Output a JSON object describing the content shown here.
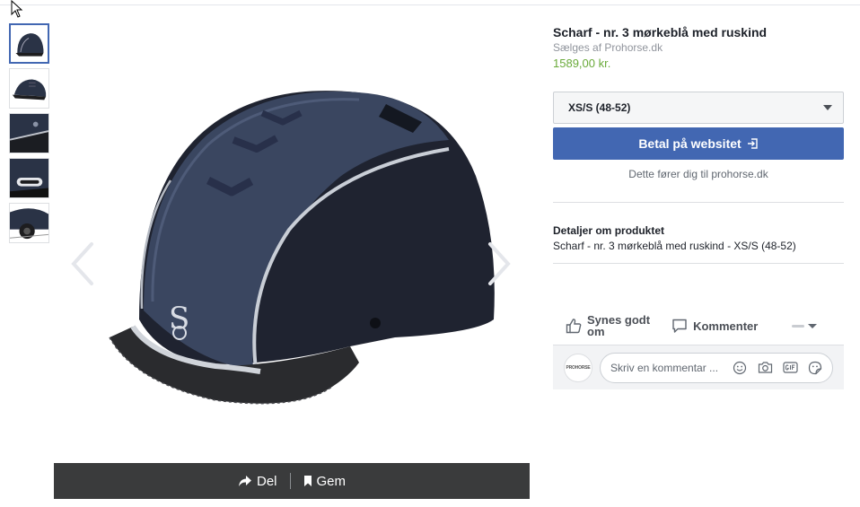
{
  "product": {
    "title": "Scharf - nr. 3 mørkeblå med ruskind",
    "seller": "Sælges af Prohorse.dk",
    "price": "1589,00 kr."
  },
  "size_select": {
    "selected": "XS/S (48-52)"
  },
  "pay_button": {
    "label": "Betal på websitet"
  },
  "redirect_note": "Dette fører dig til prohorse.dk",
  "details": {
    "heading": "Detaljer om produktet",
    "text": "Scharf - nr. 3 mørkeblå med ruskind - XS/S (48-52)"
  },
  "reactions": {
    "like_line1": "Synes godt",
    "like_line2": "om",
    "comment": "Kommenter"
  },
  "comment_input": {
    "placeholder": "Skriv en kommentar ...",
    "avatar_text": "PROHORSE"
  },
  "image_actions": {
    "share": "Del",
    "save": "Gem"
  },
  "thumbnails": [
    "thumb-1",
    "thumb-2",
    "thumb-3",
    "thumb-4",
    "thumb-5"
  ],
  "colors": {
    "accent": "#4267b2",
    "price": "#6aaa3a",
    "helmet": "#2a3346"
  },
  "icons": [
    "cursor-icon",
    "chevron-left-icon",
    "chevron-right-icon",
    "share-arrow-icon",
    "bookmark-icon",
    "external-link-icon",
    "thumbs-up-icon",
    "comment-bubble-icon",
    "smiley-icon",
    "camera-icon",
    "gif-icon",
    "sticker-icon"
  ]
}
